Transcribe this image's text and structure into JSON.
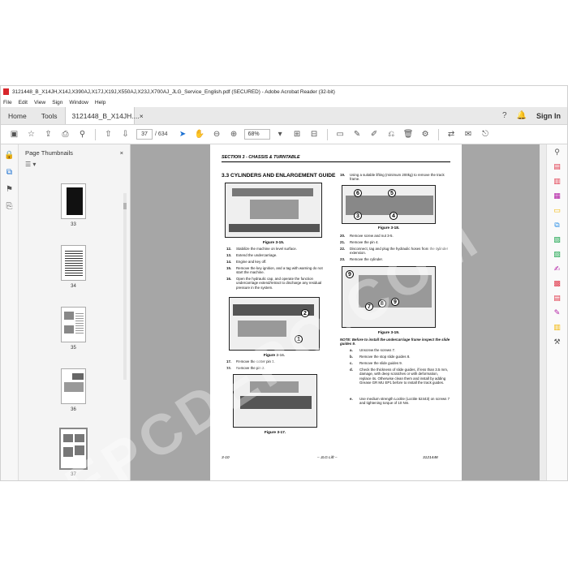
{
  "window": {
    "title": "3121448_B_X14JH,X14J,X390AJ,X17J,X19J,X550AJ,X23J,X700AJ_JLG_Service_English.pdf (SECURED) - Adobe Acrobat Reader (32-bit)"
  },
  "menu": [
    "File",
    "Edit",
    "View",
    "Sign",
    "Window",
    "Help"
  ],
  "tabs": {
    "home": "Home",
    "tools": "Tools",
    "document": "3121448_B_X14JH....",
    "close": "×",
    "sign_in": "Sign In"
  },
  "toolbar": {
    "current_page": "37",
    "total_pages": "/ 634",
    "zoom": "68%"
  },
  "thumbnails": {
    "title": "Page Thumbnails",
    "close": "×",
    "pages": [
      "33",
      "34",
      "35",
      "36",
      "37"
    ]
  },
  "page": {
    "section": "SECTION 3 - CHASSIS & TURNTABLE",
    "heading": "3.3 CYLINDERS AND ENLARGEMENT GUIDE",
    "figures": {
      "f15": "Figure 3-15.",
      "f16": "Figure 3-16.",
      "f17": "Figure 3-17.",
      "f18": "Figure 3-18.",
      "f19": "Figure 3-19."
    },
    "left_steps": [
      {
        "n": "12.",
        "t": "Stabilize the machine on level surface."
      },
      {
        "n": "13.",
        "t": "Extend the undercarriage."
      },
      {
        "n": "14.",
        "t": "Engine and key off."
      },
      {
        "n": "15.",
        "t": "Remove the key ignition, and a tag with warning do not start the machine."
      },
      {
        "n": "16.",
        "t": "Open the hydraulic cap, and operate the function undercarriage extend/retract to discharge any residual pressure in the system."
      }
    ],
    "left_steps2": [
      {
        "n": "17.",
        "t": "Remove the cotter pin 1."
      },
      {
        "n": "18.",
        "t": "Remove the pin 2."
      }
    ],
    "right_step19": {
      "n": "19.",
      "t": "Using a suitable lifting (minimum 200kg) to remove the track frame."
    },
    "right_steps": [
      {
        "n": "20.",
        "t": "Remove screw and nut 3-5."
      },
      {
        "n": "21.",
        "t": "Remove the pin 4."
      },
      {
        "n": "22.",
        "t": "Disconnect, tag and plug the hydraulic hoses from the cylinder extension."
      },
      {
        "n": "23.",
        "t": "Remove the cylinder."
      }
    ],
    "note": "NOTE: Before to install the undercarriage frame inspect the slide guides 9.",
    "sub_steps": [
      {
        "n": "a.",
        "t": "Unscrew the screws 7."
      },
      {
        "n": "b.",
        "t": "Remove the stop slide guides 8."
      },
      {
        "n": "c.",
        "t": "Remove the slide guides 9."
      },
      {
        "n": "d.",
        "t": "Check the thickness of slide guides, if less than 3.5 mm, damage, with deep scratches or with deformation, replace its. Otherwise clean them and install by adding Grease GR MU EP1 before to install the track guides."
      },
      {
        "n": "e.",
        "t": "Use medium strength Loctite (Loctite 52443) on screws 7 and tightening torque of 10 Nm."
      }
    ],
    "callouts": {
      "c1": "1",
      "c2": "2",
      "c3": "3",
      "c4": "4",
      "c5": "5",
      "c6": "6",
      "c7": "7",
      "c8": "8",
      "c9": "9"
    },
    "footer_left": "3-10",
    "footer_center": "– JLG Lift –",
    "footer_right": "3121448"
  },
  "watermark": "EPCDEPO.COM",
  "colors": {
    "accent": "#1a6fd1",
    "pdf_icon": "#d7262b"
  }
}
